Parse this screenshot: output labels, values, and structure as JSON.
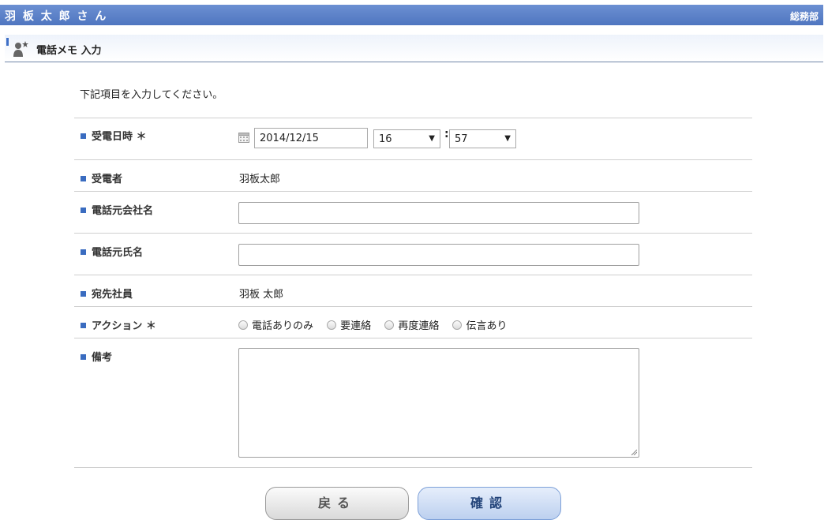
{
  "header": {
    "user_name": "羽 板 太 郎 さ ん",
    "department": "総務部"
  },
  "section": {
    "title": "電話メモ 入力",
    "icon": "person-star-icon"
  },
  "intro": "下記項目を入力してください。",
  "form": {
    "received_datetime": {
      "label": "受電日時 ＊",
      "date": "2014/12/15",
      "hour": "16",
      "minute": "57",
      "separator": ":",
      "icon": "calendar-icon"
    },
    "receiver": {
      "label": "受電者",
      "value": "羽板太郎"
    },
    "caller_company": {
      "label": "電話元会社名",
      "value": ""
    },
    "caller_name": {
      "label": "電話元氏名",
      "value": ""
    },
    "recipient": {
      "label": "宛先社員",
      "value": "羽板 太郎"
    },
    "action": {
      "label": "アクション ＊",
      "options": [
        "電話ありのみ",
        "要連絡",
        "再度連絡",
        "伝言あり"
      ]
    },
    "remarks": {
      "label": "備考",
      "value": ""
    }
  },
  "buttons": {
    "back": "戻る",
    "confirm": "確認"
  },
  "colors": {
    "accent": "#4f76c0",
    "label_marker": "#3a6cc0"
  }
}
